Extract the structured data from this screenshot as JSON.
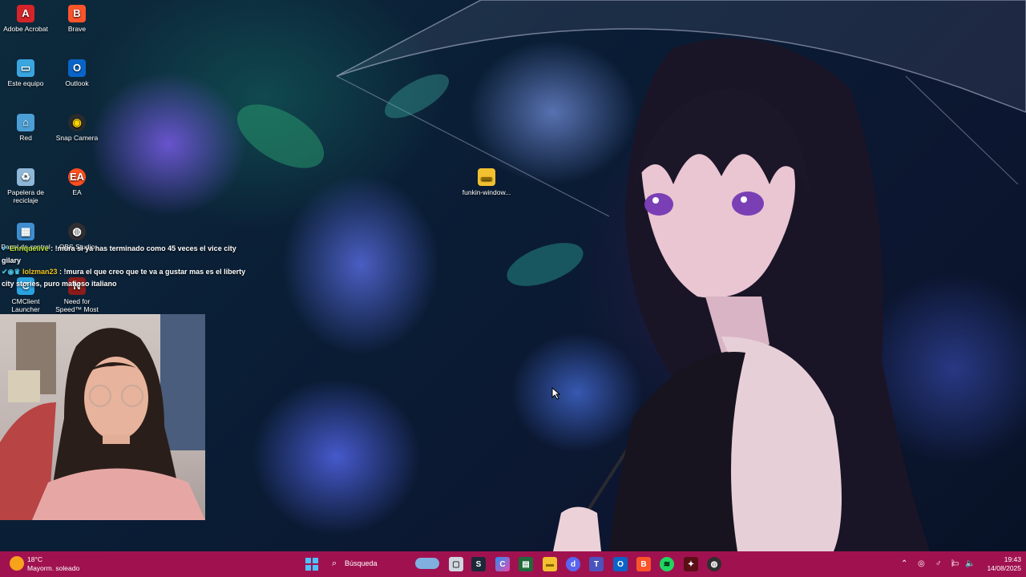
{
  "desktop": {
    "icons": [
      {
        "label": "Adobe Acrobat"
      },
      {
        "label": "Brave"
      },
      {
        "label": "Este equipo"
      },
      {
        "label": "Outlook"
      },
      {
        "label": "Red"
      },
      {
        "label": "Snap Camera"
      },
      {
        "label": "Papelera de reciclaje"
      },
      {
        "label": "EA"
      },
      {
        "label": "Panel de control"
      },
      {
        "label": "OBS Studio"
      },
      {
        "label": "CMClient Launcher"
      },
      {
        "label": "Need for Speed™ Most Wanted"
      },
      {
        "label": "funkin-window..."
      }
    ]
  },
  "chat": {
    "messages": [
      {
        "user": "Enriquelive",
        "text": ": !mura si ya has terminado como 45 veces el vice city gilary"
      },
      {
        "user": "lolzman23",
        "text": ": !mura el que creo que te va a gustar mas es el liberty city stories, puro mafioso italiano"
      }
    ]
  },
  "taskbar": {
    "weather": {
      "temp": "18°C",
      "desc": "Mayorm. soleado"
    },
    "search_label": "Búsqueda",
    "clock": {
      "time": "19:43",
      "date": "14/08/2025"
    },
    "colors": {
      "taskbar": "#a0124f"
    }
  }
}
